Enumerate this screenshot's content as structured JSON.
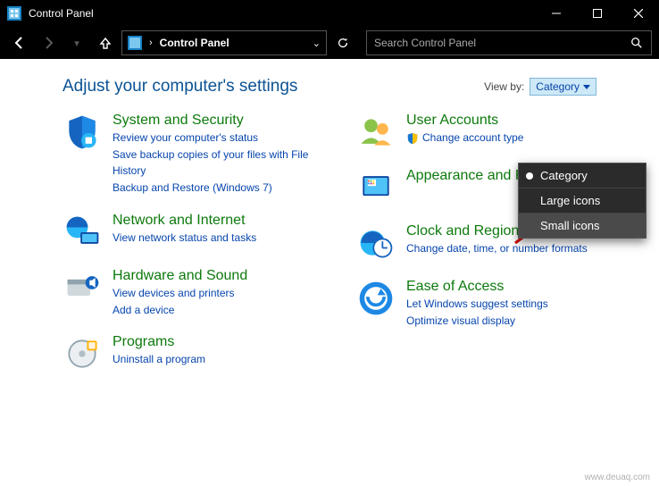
{
  "window": {
    "title": "Control Panel"
  },
  "nav": {
    "breadcrumb": "Control Panel",
    "search_placeholder": "Search Control Panel"
  },
  "header": {
    "page_title": "Adjust your computer's settings",
    "view_by_label": "View by:",
    "view_by_value": "Category"
  },
  "dropdown": {
    "items": [
      {
        "label": "Category",
        "selected": true
      },
      {
        "label": "Large icons",
        "selected": false
      },
      {
        "label": "Small icons",
        "selected": false
      }
    ]
  },
  "left_col": [
    {
      "title": "System and Security",
      "links": [
        "Review your computer's status",
        "Save backup copies of your files with File History",
        "Backup and Restore (Windows 7)"
      ]
    },
    {
      "title": "Network and Internet",
      "links": [
        "View network status and tasks"
      ]
    },
    {
      "title": "Hardware and Sound",
      "links": [
        "View devices and printers",
        "Add a device"
      ]
    },
    {
      "title": "Programs",
      "links": [
        "Uninstall a program"
      ]
    }
  ],
  "right_col": [
    {
      "title": "User Accounts",
      "links": [
        "Change account type"
      ],
      "shield": true
    },
    {
      "title": "Appearance and Personalization",
      "links": []
    },
    {
      "title": "Clock and Region",
      "links": [
        "Change date, time, or number formats"
      ]
    },
    {
      "title": "Ease of Access",
      "links": [
        "Let Windows suggest settings",
        "Optimize visual display"
      ]
    }
  ],
  "watermark": "www.deuaq.com"
}
